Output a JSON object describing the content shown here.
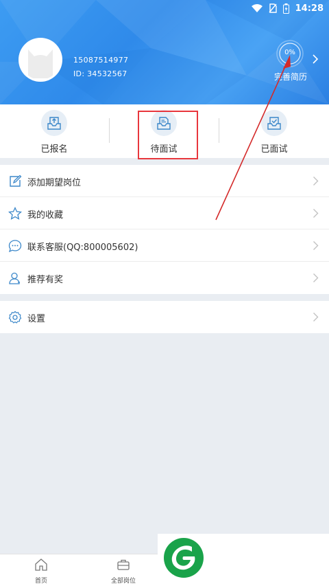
{
  "status_bar": {
    "time": "14:28"
  },
  "profile": {
    "phone": "15087514977",
    "id_text": "ID:  34532567",
    "progress_text": "0%",
    "progress_value": 0,
    "resume_label": "完善简历"
  },
  "tabs": [
    {
      "label": "已报名",
      "icon": "upload-tray-icon"
    },
    {
      "label": "待面试",
      "icon": "document-tray-icon"
    },
    {
      "label": "已面试",
      "icon": "check-tray-icon"
    }
  ],
  "menu": [
    {
      "label": "添加期望岗位",
      "icon": "edit-icon"
    },
    {
      "label": "我的收藏",
      "icon": "star-icon"
    },
    {
      "label": "联系客服(QQ:800005602)",
      "icon": "chat-icon"
    },
    {
      "label": "推荐有奖",
      "icon": "user-icon"
    }
  ],
  "settings": {
    "label": "设置",
    "icon": "gear-icon"
  },
  "bottom_nav": [
    {
      "label": "首页",
      "icon": "home-icon"
    },
    {
      "label": "全部岗位",
      "icon": "briefcase-icon"
    }
  ],
  "colors": {
    "header_blue": "#3d9cf2",
    "highlight_red": "#e8363c",
    "icon_blue": "#3b87c9",
    "logo_green": "#1aa34a"
  }
}
